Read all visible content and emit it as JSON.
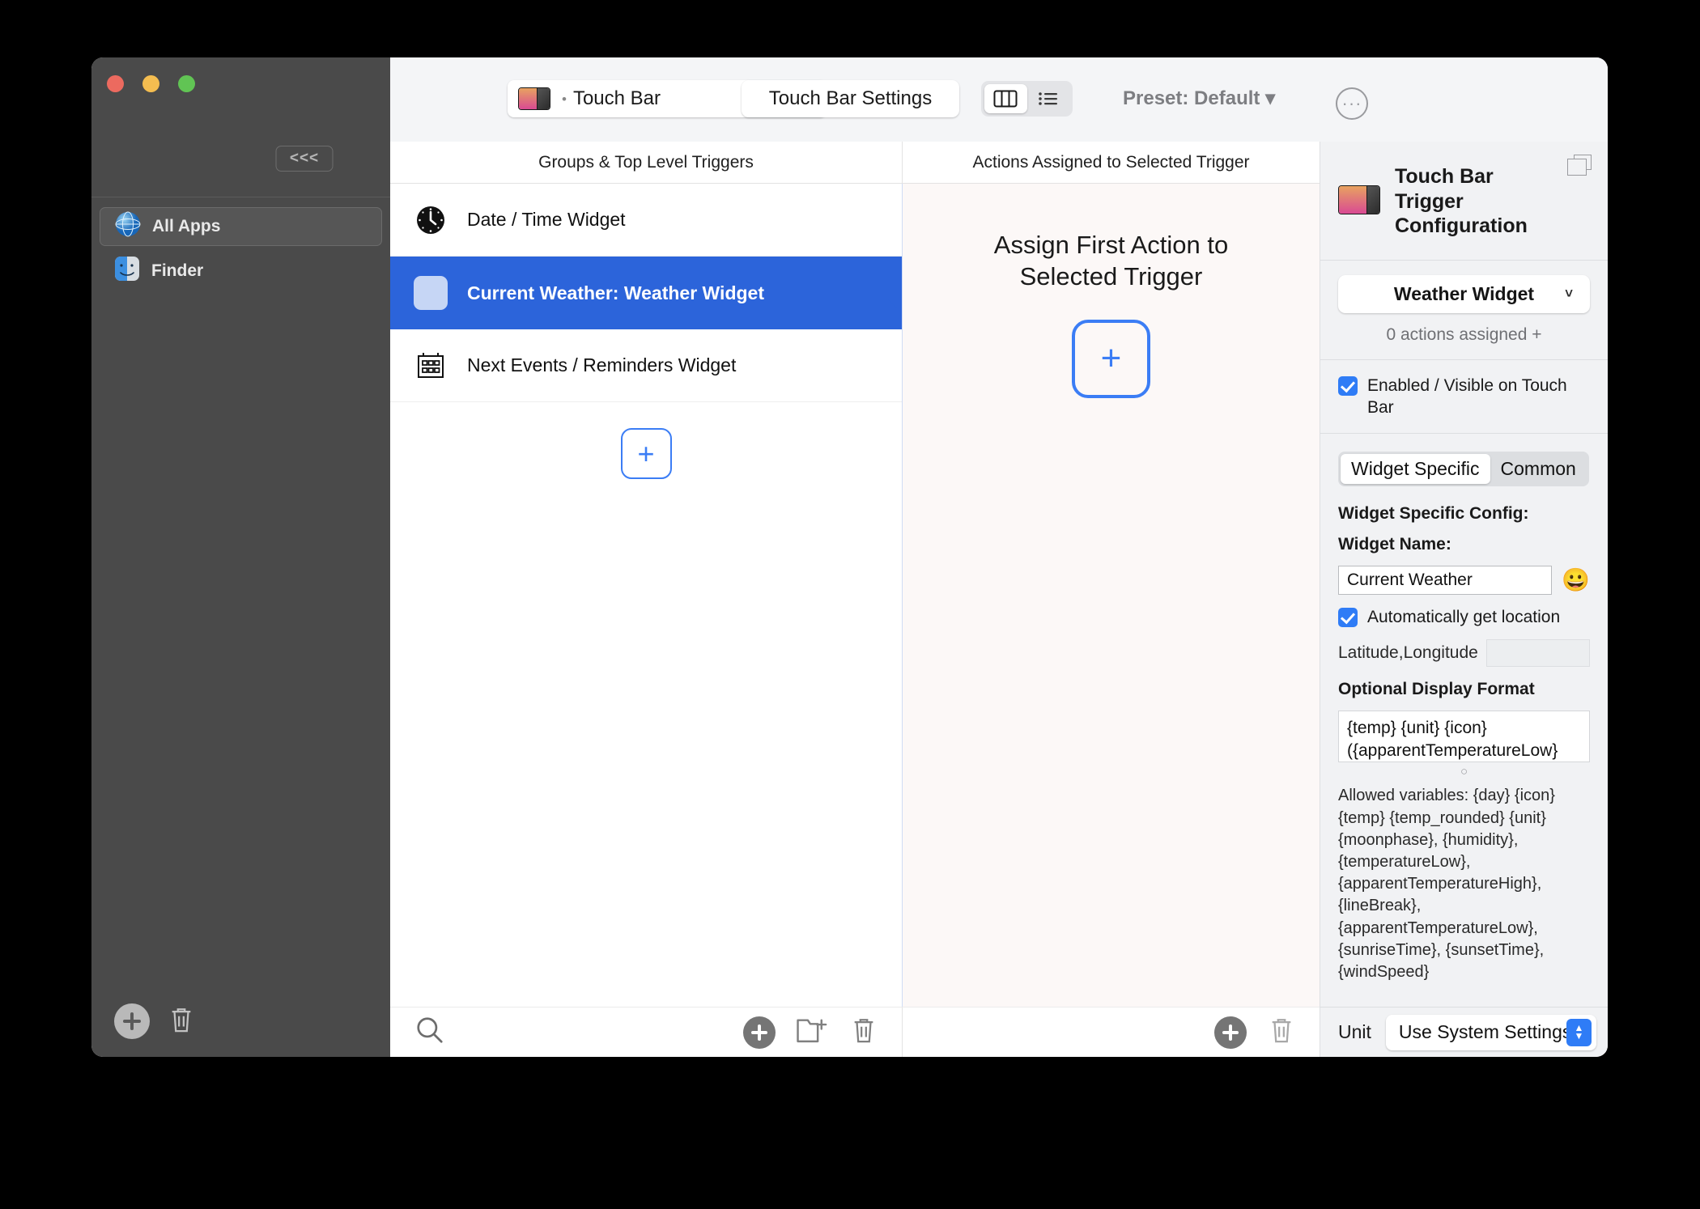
{
  "window": {
    "collapse_label": "<<<"
  },
  "sidebar": {
    "items": [
      {
        "label": "All Apps",
        "icon": "globe-icon"
      },
      {
        "label": "Finder",
        "icon": "finder-icon"
      }
    ],
    "add_label": "+",
    "delete_label": "delete-icon"
  },
  "toolbar": {
    "device_popup": {
      "bullet": "•",
      "label": "Touch Bar"
    },
    "settings_button": "Touch Bar Settings",
    "view_columns_icon": "columns-view-icon",
    "view_list_icon": "list-view-icon",
    "preset_label": "Preset: Default",
    "preset_caret": "▾",
    "more_label": "···"
  },
  "columns": {
    "groups_header": "Groups & Top Level Triggers",
    "actions_header": "Actions Assigned to Selected Trigger"
  },
  "triggers": [
    {
      "label": "Date / Time Widget",
      "icon": "clock-icon",
      "selected": false
    },
    {
      "label": "Current Weather: Weather Widget",
      "icon": "blank-square-icon",
      "selected": true
    },
    {
      "label": "Next Events / Reminders Widget",
      "icon": "calendar-icon",
      "selected": false
    }
  ],
  "triggers_add_label": "+",
  "actions_panel": {
    "empty_title_line1": "Assign First Action to",
    "empty_title_line2": "Selected Trigger",
    "add_label": "+"
  },
  "config": {
    "title_line1": "Touch Bar",
    "title_line2": "Trigger",
    "title_line3": "Configuration",
    "window_icon": "window-stack-icon",
    "trigger_type": "Weather Widget",
    "trigger_caret": "˅",
    "actions_assigned": "0 actions assigned +",
    "enabled_label": "Enabled / Visible on Touch Bar",
    "tabs": [
      {
        "label": "Widget Specific",
        "active": true
      },
      {
        "label": "Common",
        "active": false
      }
    ],
    "section_label": "Widget Specific Config:",
    "widget_name_label": "Widget Name:",
    "widget_name_value": "Current Weather",
    "emoji_button": "😀",
    "auto_location_label": "Automatically get location",
    "latlon_label": "Latitude,Longitude",
    "latlon_value": "",
    "display_format_label": "Optional Display Format",
    "display_format_value": "{temp} {unit} {icon} ({apparentTemperatureLow}",
    "allowed_variables": "Allowed variables: {day} {icon} {temp} {temp_rounded} {unit} {moonphase}, {humidity}, {temperatureLow}, {apparentTemperatureHigh}, {lineBreak}, {apparentTemperatureLow}, {sunriseTime}, {sunsetTime}, {windSpeed}",
    "unit_label": "Unit",
    "unit_value": "Use System Settings"
  },
  "bottom_bars": {
    "search_icon": "search-icon",
    "add_icon": "add-icon",
    "new_group_icon": "new-folder-icon",
    "delete_icon": "trash-icon"
  },
  "colors": {
    "accent": "#2c64da",
    "blue": "#3b7df5",
    "sidebar_bg": "#4a4a4a",
    "panel_bg": "#f1f2f4"
  }
}
